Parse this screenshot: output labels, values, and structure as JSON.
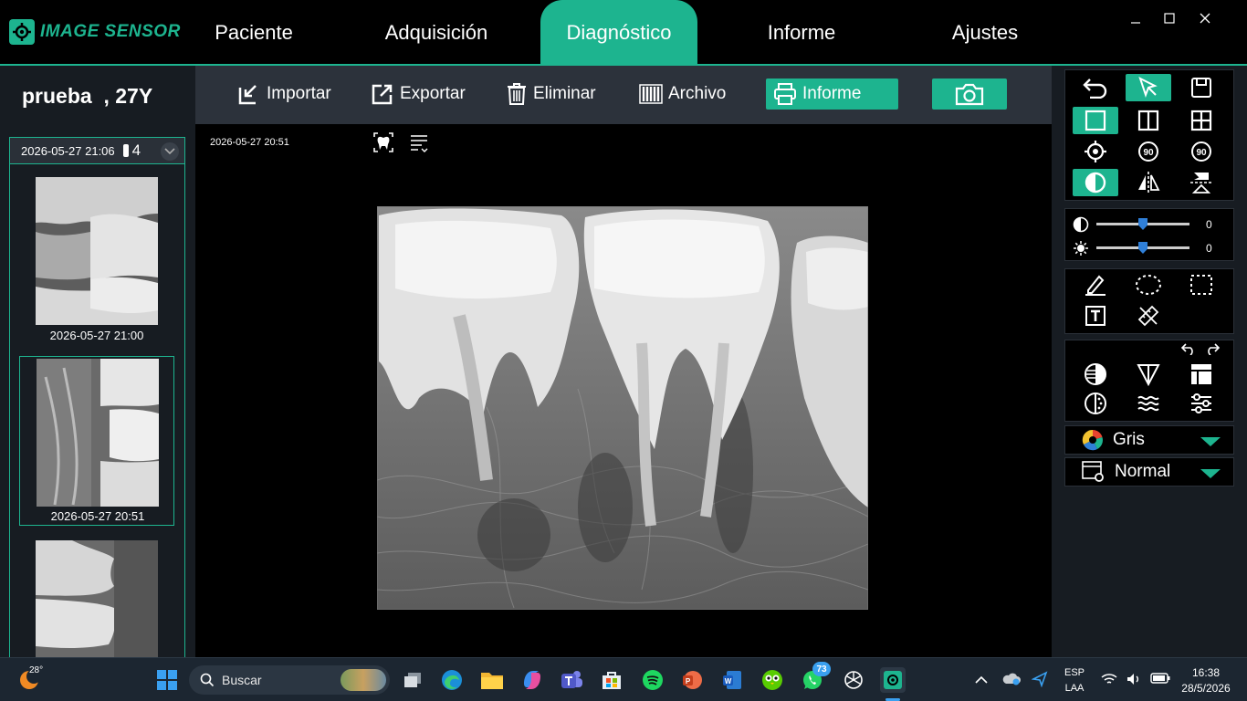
{
  "app": {
    "logo_text": "IMAGE SENSOR"
  },
  "nav": {
    "tabs": [
      {
        "label": "Paciente"
      },
      {
        "label": "Adquisición"
      },
      {
        "label": "Diagnóstico",
        "active": true
      },
      {
        "label": "Informe"
      },
      {
        "label": "Ajustes"
      }
    ]
  },
  "patient": {
    "display": "prueba  , 27Y"
  },
  "series": {
    "header_date": "2026-05-27 21:06",
    "image_count": "4",
    "thumbnails": [
      {
        "label": "2026-05-27 21:00"
      },
      {
        "label": "2026-05-27 20:51",
        "selected": true
      },
      {
        "label": ""
      }
    ]
  },
  "toolbar": {
    "importar": "Importar",
    "exportar": "Exportar",
    "eliminar": "Eliminar",
    "archivo": "Archivo",
    "informe": "Informe"
  },
  "viewer": {
    "image_date": "2026-05-27 20:51"
  },
  "adjust": {
    "contrast_value": "0",
    "brightness_value": "0",
    "contrast_level": 0.5,
    "brightness_level": 0.5
  },
  "palette": {
    "selected": "Gris"
  },
  "mode": {
    "selected": "Normal"
  },
  "taskbar": {
    "weather_temp": "28°",
    "search_placeholder": "Buscar",
    "whatsapp_badge": "73",
    "lang_top": "ESP",
    "lang_bottom": "LAA",
    "time": "16:38",
    "date": "28/5/2026"
  },
  "colors": {
    "accent": "#1db48f",
    "panel": "#171c22",
    "toolbar": "#2c323b",
    "slider_knob": "#2f7fd8"
  }
}
